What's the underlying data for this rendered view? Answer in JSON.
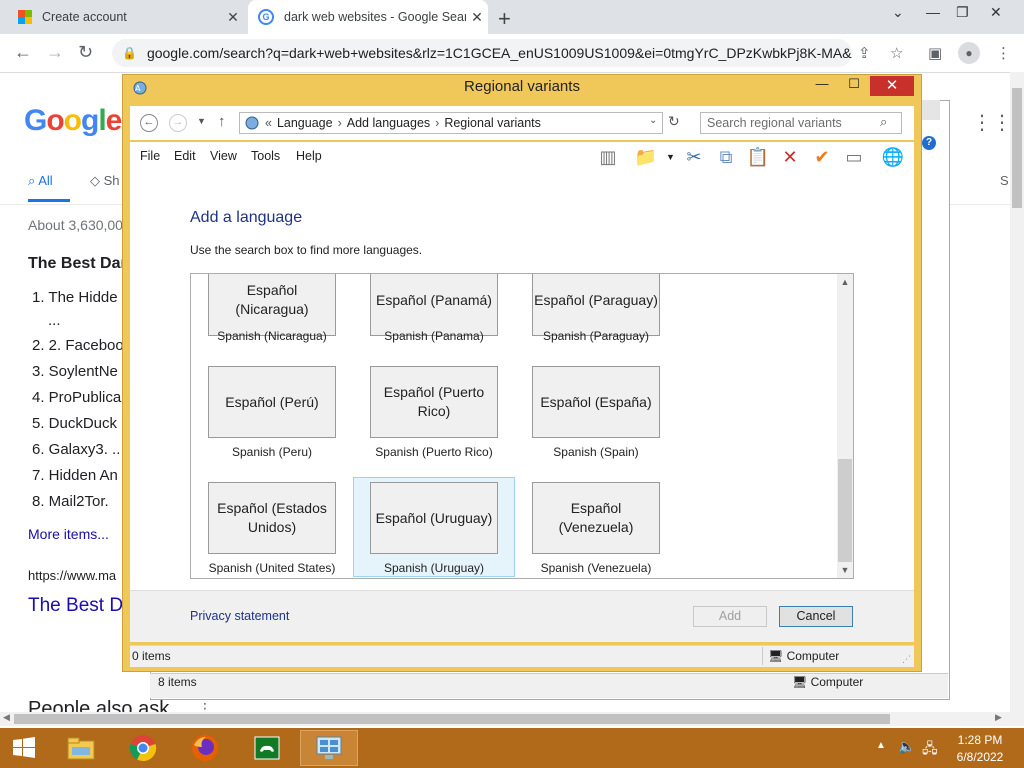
{
  "browser": {
    "tabs": [
      {
        "title": "Create account",
        "active": false
      },
      {
        "title": "dark web websites - Google Sear",
        "active": true
      }
    ],
    "url": "google.com/search?q=dark+web+websites&rlz=1C1GCEA_enUS1009US1009&ei=0tmgYrC_DPzKwbkPj8K-MA&..."
  },
  "google": {
    "logo": "Google",
    "tab_all": "All",
    "tab_sh": "Sh",
    "tab_right": "S",
    "result_count": "About 3,630,00",
    "best": "The Best Darl",
    "list": [
      "1. The Hidde",
      "...",
      "2. 2. Faceboo",
      "3. SoylentNe",
      "4. ProPublica",
      "5. DuckDuck",
      "6. Galaxy3. ..",
      "7. Hidden An",
      "8. Mail2Tor."
    ],
    "more_items": "More items...",
    "url_line": "https://www.ma",
    "result_title": "The Best D",
    "people_also": "People also ask"
  },
  "behind_window": {
    "items": "8 items",
    "computer": "Computer"
  },
  "dialog": {
    "title": "Regional variants",
    "breadcrumbs": [
      "Language",
      "Add languages",
      "Regional variants"
    ],
    "crumb_prefix": "«",
    "search_placeholder": "Search regional variants",
    "menu": [
      "File",
      "Edit",
      "View",
      "Tools",
      "Help"
    ],
    "heading": "Add a language",
    "instruction": "Use the search box to find more languages.",
    "languages": [
      {
        "native": "Español (Nicaragua)",
        "english": "Spanish (Nicaragua)",
        "selected": false
      },
      {
        "native": "Español (Panamá)",
        "english": "Spanish (Panama)",
        "selected": false
      },
      {
        "native": "Español (Paraguay)",
        "english": "Spanish (Paraguay)",
        "selected": false
      },
      {
        "native": "Español (Perú)",
        "english": "Spanish (Peru)",
        "selected": false
      },
      {
        "native": "Español (Puerto Rico)",
        "english": "Spanish (Puerto Rico)",
        "selected": false
      },
      {
        "native": "Español (España)",
        "english": "Spanish (Spain)",
        "selected": false
      },
      {
        "native": "Español (Estados Unidos)",
        "english": "Spanish (United States)",
        "selected": false
      },
      {
        "native": "Español (Uruguay)",
        "english": "Spanish (Uruguay)",
        "selected": true
      },
      {
        "native": "Español (Venezuela)",
        "english": "Spanish (Venezuela)",
        "selected": false
      }
    ],
    "privacy": "Privacy statement",
    "add_button": "Add",
    "cancel_button": "Cancel",
    "status_items": "0 items",
    "status_computer": "Computer"
  },
  "taskbar": {
    "time": "1:28 PM",
    "date": "6/8/2022"
  },
  "colors": {
    "window_frame": "#f0c85a",
    "taskbar": "#b06a19",
    "heading_blue": "#1e3287",
    "link_blue": "#1a0dab"
  }
}
